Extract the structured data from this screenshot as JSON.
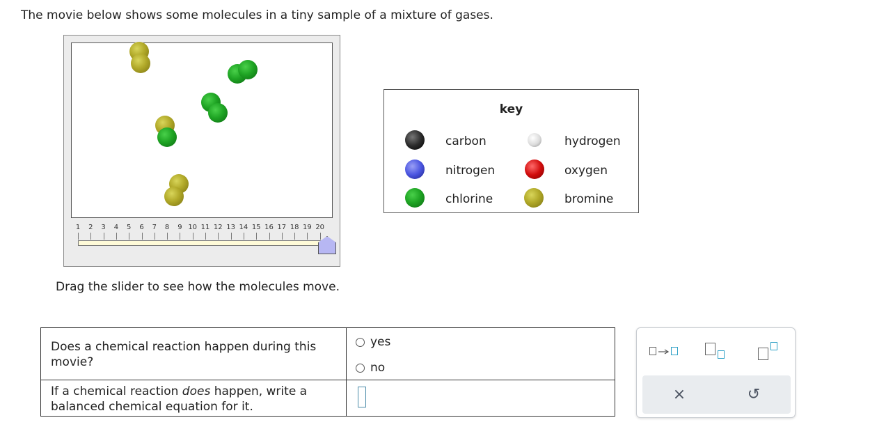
{
  "prompt": "The movie below shows some molecules in a tiny sample of a mixture of gases.",
  "movie": {
    "slider": {
      "ticks": [
        "1",
        "2",
        "3",
        "4",
        "5",
        "6",
        "7",
        "8",
        "9",
        "10",
        "11",
        "12",
        "13",
        "14",
        "15",
        "16",
        "17",
        "18",
        "19",
        "20"
      ],
      "current_frame": 20,
      "max_frame": 20
    },
    "hint": "Drag the slider to see how the molecules move."
  },
  "key": {
    "title": "key",
    "items": [
      {
        "label": "carbon",
        "color": "#111111"
      },
      {
        "label": "hydrogen",
        "color": "#e6e6e6"
      },
      {
        "label": "nitrogen",
        "color": "#3f4fe0"
      },
      {
        "label": "oxygen",
        "color": "#d00000"
      },
      {
        "label": "chlorine",
        "color": "#16a016"
      },
      {
        "label": "bromine",
        "color": "#a89f1c"
      }
    ]
  },
  "question": {
    "q1_text": "Does a chemical reaction happen during this movie?",
    "options": [
      "yes",
      "no"
    ],
    "q2_prefix": "If a chemical reaction ",
    "q2_emphasis": "does",
    "q2_suffix": " happen, write a balanced chemical equation for it."
  },
  "palette": {
    "tools": [
      "arrow-template-icon",
      "subscript-template-icon",
      "superscript-template-icon"
    ],
    "actions": {
      "clear": "×",
      "undo": "↺"
    }
  }
}
